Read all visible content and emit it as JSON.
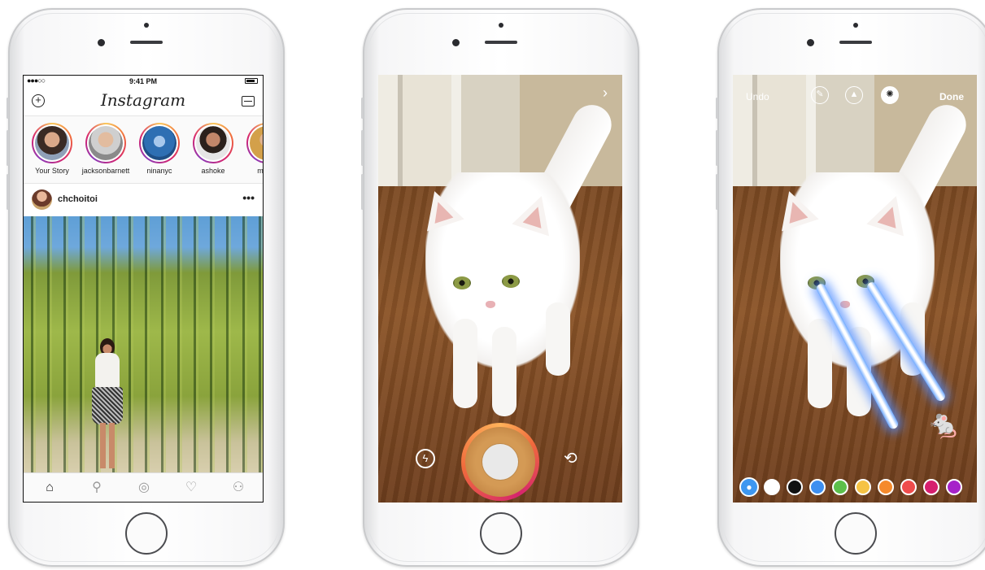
{
  "phone1": {
    "status": {
      "carrier": "●●●○○",
      "time": "9:41 PM"
    },
    "header": {
      "logo": "Instagram",
      "add_icon": "plus-circle-icon",
      "inbox_icon": "inbox-icon"
    },
    "stories": [
      {
        "name": "Your Story",
        "face_color": "#7a5a4a"
      },
      {
        "name": "jacksonbarnett",
        "face_color": "#b89a82"
      },
      {
        "name": "ninanyc",
        "face_color": "#2e6fb3"
      },
      {
        "name": "ashoke",
        "face_color": "#c2876a"
      },
      {
        "name": "minzz",
        "face_color": "#d3a04a"
      }
    ],
    "post": {
      "user": "chchoitoi",
      "more": "•••"
    },
    "tabs": [
      {
        "icon": "home-icon",
        "glyph": "⌂"
      },
      {
        "icon": "search-icon",
        "glyph": "⚲"
      },
      {
        "icon": "camera-icon",
        "glyph": "◎"
      },
      {
        "icon": "heart-icon",
        "glyph": "♡"
      },
      {
        "icon": "profile-icon",
        "glyph": "⚇"
      }
    ]
  },
  "phone2": {
    "next_glyph": "›",
    "flash_glyph": "ϟ",
    "flip_glyph": "⟲"
  },
  "phone3": {
    "undo_label": "Undo",
    "done_label": "Done",
    "brushes": [
      {
        "icon": "marker-brush-icon",
        "glyph": "✎"
      },
      {
        "icon": "highlighter-brush-icon",
        "glyph": "▲"
      },
      {
        "icon": "neon-brush-icon",
        "glyph": "✺"
      }
    ],
    "palette": [
      "#ffffff",
      "#111111",
      "#3e8ff0",
      "#5cbf4a",
      "#f6c344",
      "#f58a2c",
      "#ef4c4c",
      "#d61f6e",
      "#a622c9"
    ],
    "accent": "#3e97f0",
    "sticker": "🐁"
  }
}
